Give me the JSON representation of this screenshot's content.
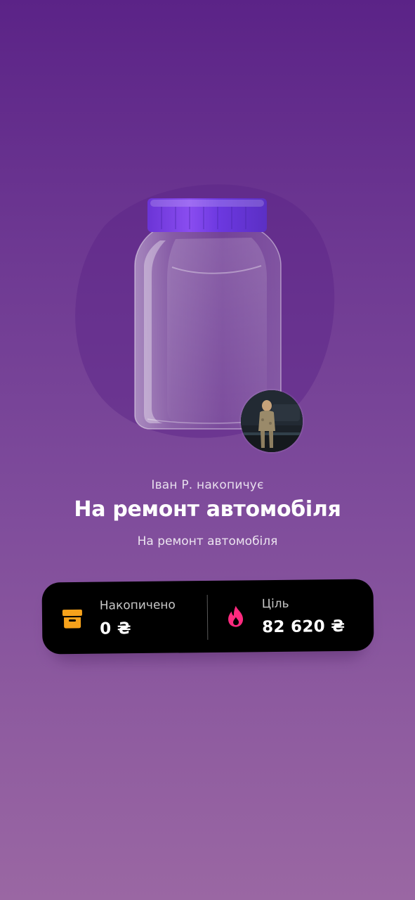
{
  "jar": {
    "owner_line": "Іван Р. накопичує",
    "title": "На ремонт автомобіля",
    "description": "На ремонт автомобіля",
    "image": "glass-jar-illustration",
    "avatar": "owner-avatar-photo"
  },
  "stats": {
    "saved": {
      "icon": "box-icon",
      "label": "Накопичено",
      "value": "0 ₴"
    },
    "goal": {
      "icon": "flame-icon",
      "label": "Ціль",
      "value": "82 620 ₴"
    }
  },
  "colors": {
    "background_top": "#5b2387",
    "background_bottom": "#9a67a3",
    "lid": "#7a3fe0",
    "card": "#000000",
    "saved_icon": "#f7a21b",
    "goal_icon": "#ff2a7f"
  }
}
